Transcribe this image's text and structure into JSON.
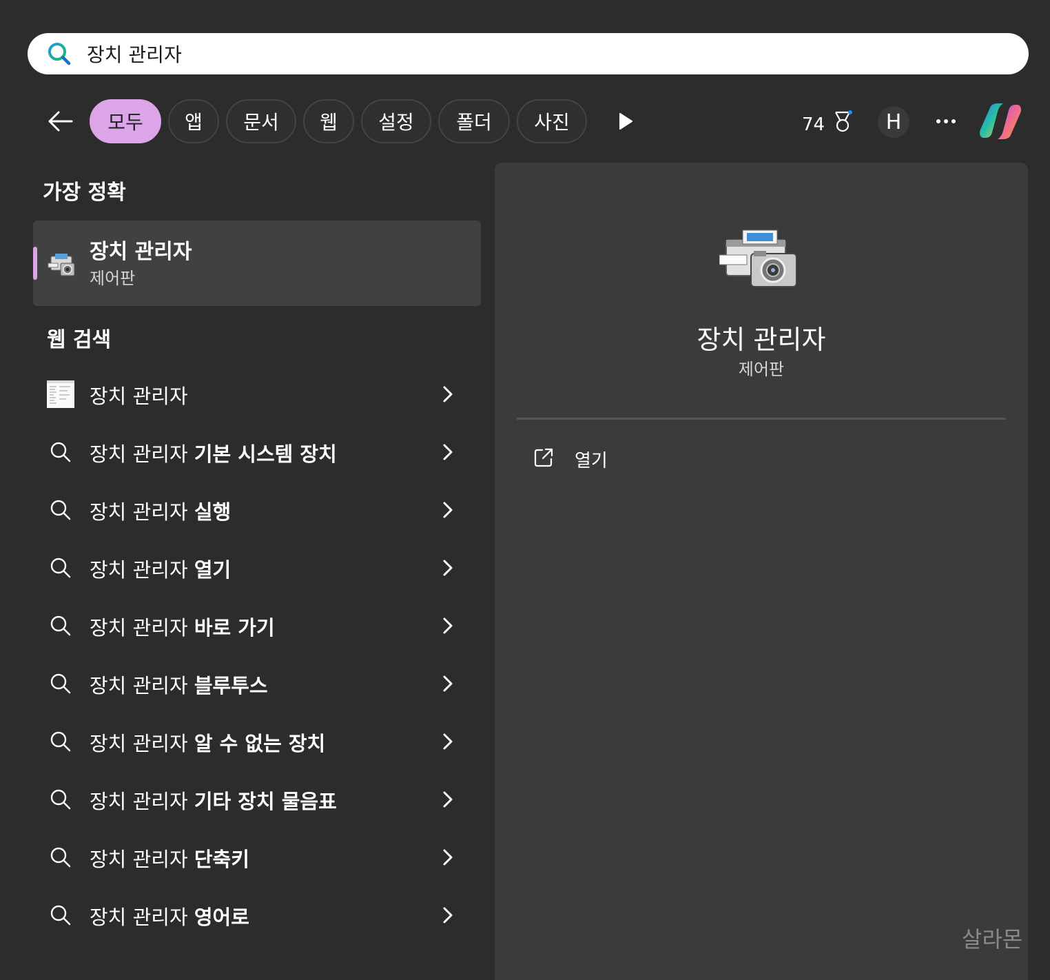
{
  "search": {
    "value": "장치 관리자",
    "icon": "search-icon"
  },
  "filters": {
    "items": [
      {
        "label": "모두",
        "active": true
      },
      {
        "label": "앱",
        "active": false
      },
      {
        "label": "문서",
        "active": false
      },
      {
        "label": "웹",
        "active": false
      },
      {
        "label": "설정",
        "active": false
      },
      {
        "label": "폴더",
        "active": false
      },
      {
        "label": "사진",
        "active": false
      }
    ],
    "points": "74",
    "avatar_initial": "H"
  },
  "best_match": {
    "heading": "가장 정확",
    "title": "장치 관리자",
    "subtitle": "제어판"
  },
  "web_search": {
    "heading": "웹 검색",
    "results": [
      {
        "prefix": "장치 관리자",
        "bold": "",
        "icon": "thumbnail-icon"
      },
      {
        "prefix": "장치 관리자 ",
        "bold": "기본 시스템 장치",
        "icon": "search-icon"
      },
      {
        "prefix": "장치 관리자 ",
        "bold": "실행",
        "icon": "search-icon"
      },
      {
        "prefix": "장치 관리자 ",
        "bold": "열기",
        "icon": "search-icon"
      },
      {
        "prefix": "장치 관리자 ",
        "bold": "바로 가기",
        "icon": "search-icon"
      },
      {
        "prefix": "장치 관리자 ",
        "bold": "블루투스",
        "icon": "search-icon"
      },
      {
        "prefix": "장치 관리자 ",
        "bold": "알 수 없는 장치",
        "icon": "search-icon"
      },
      {
        "prefix": "장치 관리자 ",
        "bold": "기타 장치 물음표",
        "icon": "search-icon"
      },
      {
        "prefix": "장치 관리자 ",
        "bold": "단축키",
        "icon": "search-icon"
      },
      {
        "prefix": "장치 관리자 ",
        "bold": "영어로",
        "icon": "search-icon"
      }
    ]
  },
  "preview": {
    "title": "장치 관리자",
    "subtitle": "제어판",
    "open_label": "열기"
  },
  "watermark": "살라몬",
  "colors": {
    "accent": "#dba5e8",
    "background": "#2c2c2c",
    "panel": "#3b3b3b"
  }
}
